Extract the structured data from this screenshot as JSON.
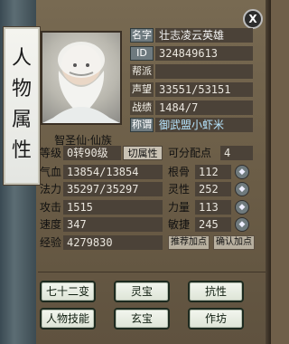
{
  "window": {
    "banner_text": "人\n物\n属\n性",
    "close_label": "X"
  },
  "portrait": {
    "caption": "智圣仙·仙族"
  },
  "header_fields": [
    {
      "label": "名字",
      "value": "壮志凌云英雄",
      "label_highlight": true
    },
    {
      "label": "ID",
      "value": "324849613",
      "label_highlight": true
    },
    {
      "label": "帮派",
      "value": "",
      "label_highlight": false
    },
    {
      "label": "声望",
      "value": "33551/53151",
      "label_highlight": false
    },
    {
      "label": "战绩",
      "value": "1484/7",
      "label_highlight": false
    },
    {
      "label": "称谓",
      "value": "御武盟小虾米",
      "label_highlight": true
    }
  ],
  "level_row": {
    "label": "等级",
    "value": "0转90级",
    "switch_button": "切属性",
    "points_label": "可分配点",
    "points_value": "4"
  },
  "stats_left": [
    {
      "label": "气血",
      "value": "13854/13854"
    },
    {
      "label": "法力",
      "value": "35297/35297"
    },
    {
      "label": "攻击",
      "value": "1515"
    },
    {
      "label": "速度",
      "value": "347"
    },
    {
      "label": "经验",
      "value": "4279830"
    }
  ],
  "stats_right": [
    {
      "label": "根骨",
      "value": "112"
    },
    {
      "label": "灵性",
      "value": "252"
    },
    {
      "label": "力量",
      "value": "113"
    },
    {
      "label": "敏捷",
      "value": "245"
    }
  ],
  "bottom_small_buttons": {
    "recommend": "推荐加点",
    "confirm": "确认加点"
  },
  "action_buttons": [
    {
      "label": "七十二变"
    },
    {
      "label": "灵宝"
    },
    {
      "label": "抗性"
    },
    {
      "label": "人物技能"
    },
    {
      "label": "玄宝"
    },
    {
      "label": "作坊"
    }
  ],
  "icons": {
    "close": "close-icon",
    "adjust": "adjust-icon"
  }
}
